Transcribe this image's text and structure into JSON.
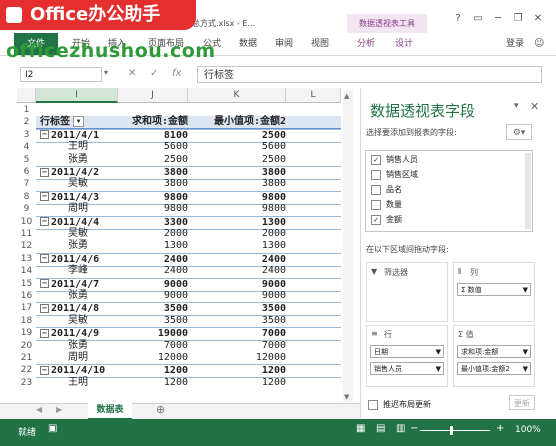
{
  "watermark": {
    "logo_text": "Office办公助手",
    "url": "officezhushou.com"
  },
  "window": {
    "title": "一个字段添加多种汇总方式.xlsx - E...",
    "context_group": "数据透视表工具"
  },
  "ribbon": {
    "file_tab": "文件",
    "tabs": [
      "开始",
      "插入",
      "页面布局",
      "公式",
      "数据",
      "审阅",
      "视图"
    ],
    "context_tabs": [
      "分析",
      "设计"
    ],
    "login": "登录"
  },
  "formula_bar": {
    "name_box": "I2",
    "cancel_icon": "✕",
    "enter_icon": "✓",
    "fx": "fx",
    "value": "行标签"
  },
  "columns": [
    {
      "label": "I",
      "selected": true
    },
    {
      "label": "J",
      "selected": false
    },
    {
      "label": "K",
      "selected": false
    },
    {
      "label": "L",
      "selected": false
    }
  ],
  "pivot": {
    "header": {
      "label": "行标签",
      "sum": "求和项:金额",
      "min": "最小值项:金额2"
    },
    "rows": [
      {
        "num": "1",
        "label": "",
        "sum": "",
        "min": "",
        "kind": "blank"
      },
      {
        "num": "2",
        "label": "行标签",
        "sum": "求和项:金额",
        "min": "最小值项:金额2",
        "kind": "header"
      },
      {
        "num": "3",
        "label": "2011/4/1",
        "sum": "8100",
        "min": "2500",
        "kind": "date"
      },
      {
        "num": "4",
        "label": "王明",
        "sum": "5600",
        "min": "5600",
        "kind": "child"
      },
      {
        "num": "5",
        "label": "张勇",
        "sum": "2500",
        "min": "2500",
        "kind": "child"
      },
      {
        "num": "6",
        "label": "2011/4/2",
        "sum": "3800",
        "min": "3800",
        "kind": "date"
      },
      {
        "num": "7",
        "label": "吴敏",
        "sum": "3800",
        "min": "3800",
        "kind": "child"
      },
      {
        "num": "8",
        "label": "2011/4/3",
        "sum": "9800",
        "min": "9800",
        "kind": "date"
      },
      {
        "num": "9",
        "label": "周明",
        "sum": "9800",
        "min": "9800",
        "kind": "child"
      },
      {
        "num": "10",
        "label": "2011/4/4",
        "sum": "3300",
        "min": "1300",
        "kind": "date"
      },
      {
        "num": "11",
        "label": "吴敏",
        "sum": "2000",
        "min": "2000",
        "kind": "child"
      },
      {
        "num": "12",
        "label": "张勇",
        "sum": "1300",
        "min": "1300",
        "kind": "child"
      },
      {
        "num": "13",
        "label": "2011/4/6",
        "sum": "2400",
        "min": "2400",
        "kind": "date"
      },
      {
        "num": "14",
        "label": "李峰",
        "sum": "2400",
        "min": "2400",
        "kind": "child"
      },
      {
        "num": "15",
        "label": "2011/4/7",
        "sum": "9000",
        "min": "9000",
        "kind": "date"
      },
      {
        "num": "16",
        "label": "张勇",
        "sum": "9000",
        "min": "9000",
        "kind": "child"
      },
      {
        "num": "17",
        "label": "2011/4/8",
        "sum": "3500",
        "min": "3500",
        "kind": "date"
      },
      {
        "num": "18",
        "label": "吴敏",
        "sum": "3500",
        "min": "3500",
        "kind": "child"
      },
      {
        "num": "19",
        "label": "2011/4/9",
        "sum": "19000",
        "min": "7000",
        "kind": "date"
      },
      {
        "num": "20",
        "label": "张勇",
        "sum": "7000",
        "min": "7000",
        "kind": "child"
      },
      {
        "num": "21",
        "label": "周明",
        "sum": "12000",
        "min": "12000",
        "kind": "child"
      },
      {
        "num": "22",
        "label": "2011/4/10",
        "sum": "1200",
        "min": "1200",
        "kind": "date"
      },
      {
        "num": "23",
        "label": "王明",
        "sum": "1200",
        "min": "1200",
        "kind": "child"
      }
    ]
  },
  "sheet": {
    "tab": "数据表",
    "add": "⊕"
  },
  "pane": {
    "title": "数据透视表字段",
    "subtitle": "选择要添加到报表的字段:",
    "fields": [
      {
        "label": "销售人员",
        "checked": true
      },
      {
        "label": "销售区域",
        "checked": false
      },
      {
        "label": "品名",
        "checked": false
      },
      {
        "label": "数量",
        "checked": false
      },
      {
        "label": "金额",
        "checked": true
      }
    ],
    "drag_hint": "在以下区域间拖动字段:",
    "filters_label": "筛选器",
    "columns_label": "列",
    "columns_items": [
      "Σ 数值"
    ],
    "rows_label": "行",
    "rows_items": [
      "日期",
      "销售人员"
    ],
    "values_label": "Σ 值",
    "values_items": [
      "求和项:金额",
      "最小值项:金额2"
    ],
    "defer_label": "推迟布局更新",
    "update_label": "更新"
  },
  "status": {
    "ready": "就绪",
    "zoom": "100%"
  },
  "colors": {
    "excel_green": "#217346",
    "context_purple": "#8a3a8a",
    "watermark_red": "#e52f2f"
  }
}
